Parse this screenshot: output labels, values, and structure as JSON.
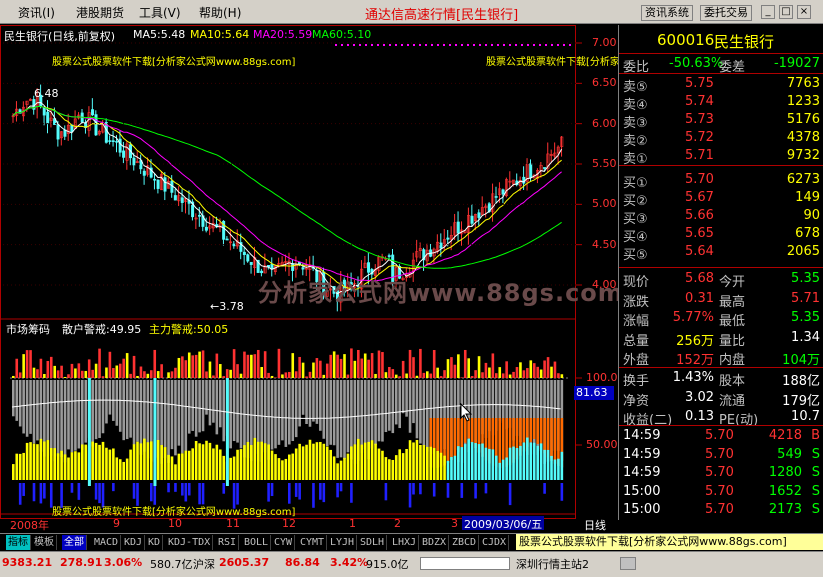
{
  "menu": {
    "items": [
      "资讯(I)",
      "港股期货",
      "工具(V)",
      "帮助(H)"
    ]
  },
  "app_title": "通达信高速行情[民生银行]",
  "top_buttons": [
    "资讯系统",
    "委托交易"
  ],
  "window_controls": [
    "_",
    "□",
    "×"
  ],
  "chart": {
    "header": "民生银行(日线,前复权)",
    "ma5": "MA5:5.48",
    "ma10": "MA10:5.64",
    "ma20": "MA20:5.59",
    "ma60": "MA60:5.10",
    "ad_text": "股票公式股票软件下载[分析家公式网www.88gs.com]",
    "watermark": "分析家公式网www.88gs.com",
    "high_label": "6.48",
    "low_label": "←3.78",
    "price_ticks": [
      "7.00",
      "6.50",
      "6.00",
      "5.50",
      "5.00",
      "4.50",
      "4.00"
    ],
    "indicator_header": "市场筹码",
    "retail_alert": "散户警戒:49.95",
    "main_alert": "主力警戒:50.05",
    "indicator_ticks": [
      "100.0",
      "50.00"
    ],
    "indicator_value": "81.63",
    "date_ticks": [
      "2008年",
      "9",
      "10",
      "11",
      "12",
      "1",
      "2",
      "3"
    ],
    "cursor_date": "2009/03/06/五",
    "period": "日线",
    "colors": {
      "up": "#ff3232",
      "down": "#54fcfc",
      "ma5": "#ffffff",
      "ma10": "#ffff00",
      "ma20": "#ff00ff",
      "ma60": "#00ff00",
      "axis": "#b00000"
    }
  },
  "quote": {
    "code": "600016",
    "name": "民生银行",
    "weibi_label": "委比",
    "weibi": "-50.63%",
    "weicha_label": "委差",
    "weicha": "-19027",
    "asks": [
      {
        "label": "卖⑤",
        "price": "5.75",
        "vol": "7763"
      },
      {
        "label": "卖④",
        "price": "5.74",
        "vol": "1233"
      },
      {
        "label": "卖③",
        "price": "5.73",
        "vol": "5176"
      },
      {
        "label": "卖②",
        "price": "5.72",
        "vol": "4378"
      },
      {
        "label": "卖①",
        "price": "5.71",
        "vol": "9732"
      }
    ],
    "bids": [
      {
        "label": "买①",
        "price": "5.70",
        "vol": "6273"
      },
      {
        "label": "买②",
        "price": "5.67",
        "vol": "149"
      },
      {
        "label": "买③",
        "price": "5.66",
        "vol": "90"
      },
      {
        "label": "买④",
        "price": "5.65",
        "vol": "678"
      },
      {
        "label": "买⑤",
        "price": "5.64",
        "vol": "2065"
      }
    ],
    "stats1": [
      {
        "l1": "现价",
        "v1": "5.68",
        "c1": "#ff3232",
        "l2": "今开",
        "v2": "5.35",
        "c2": "#00ff00"
      },
      {
        "l1": "涨跌",
        "v1": "0.31",
        "c1": "#ff3232",
        "l2": "最高",
        "v2": "5.71",
        "c2": "#ff3232"
      },
      {
        "l1": "涨幅",
        "v1": "5.77%",
        "c1": "#ff3232",
        "l2": "最低",
        "v2": "5.35",
        "c2": "#00ff00"
      },
      {
        "l1": "总量",
        "v1": "256万",
        "c1": "#ffff00",
        "l2": "量比",
        "v2": "1.34",
        "c2": "#ffffff"
      },
      {
        "l1": "外盘",
        "v1": "152万",
        "c1": "#ff3232",
        "l2": "内盘",
        "v2": "104万",
        "c2": "#00ff00"
      }
    ],
    "stats2": [
      {
        "l1": "换手",
        "v1": "1.43%",
        "c1": "#ffffff",
        "l2": "股本",
        "v2": "188亿",
        "c2": "#ffffff"
      },
      {
        "l1": "净资",
        "v1": "3.02",
        "c1": "#ffffff",
        "l2": "流通",
        "v2": "179亿",
        "c2": "#ffffff"
      },
      {
        "l1": "收益(二)",
        "v1": "0.13",
        "c1": "#ffffff",
        "l2": "PE(动)",
        "v2": "10.7",
        "c2": "#ffffff"
      }
    ],
    "ticks": [
      {
        "t": "14:59",
        "p": "5.70",
        "v": "4218",
        "bs": "B",
        "c": "#ff3232"
      },
      {
        "t": "14:59",
        "p": "5.70",
        "v": "549",
        "bs": "S",
        "c": "#00ff00"
      },
      {
        "t": "14:59",
        "p": "5.70",
        "v": "1280",
        "bs": "S",
        "c": "#00ff00"
      },
      {
        "t": "15:00",
        "p": "5.70",
        "v": "1652",
        "bs": "S",
        "c": "#00ff00"
      },
      {
        "t": "15:00",
        "p": "5.70",
        "v": "2173",
        "bs": "S",
        "c": "#00ff00"
      }
    ],
    "ad_banner": "股票公式股票软件下载[分析家公式网www.88gs.com]"
  },
  "tabs": [
    "指标",
    "模板",
    "全部",
    "MACD",
    "KDJ",
    "KD",
    "KDJ-TDX",
    "RSI",
    "BOLL",
    "CYW",
    "CYMT",
    "LYJH",
    "SDLH",
    "LHXJ",
    "BDZX",
    "ZBCD",
    "CJDX"
  ],
  "status": {
    "sh_index": "9383.21",
    "sh_change": "278.91",
    "sh_pct": "3.06%",
    "sh_amount": "580.7亿",
    "sz_label": "沪深",
    "sz_index": "2605.37",
    "sz_change": "86.84",
    "sz_pct": "3.42%",
    "sz_amount": "915.0亿",
    "server": "深圳行情主站2"
  }
}
